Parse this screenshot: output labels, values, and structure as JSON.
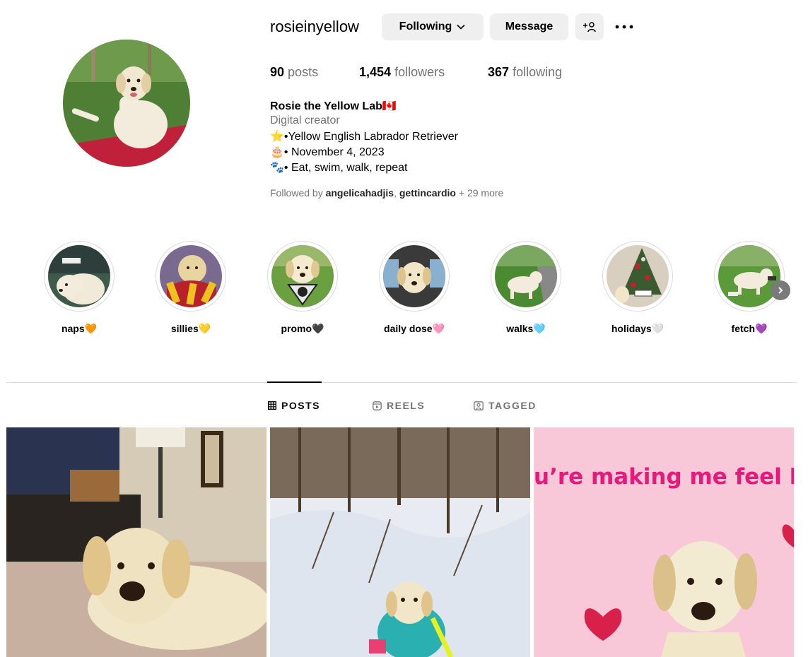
{
  "profile": {
    "username": "rosieinyellow",
    "following_btn": "Following",
    "message_btn": "Message",
    "add_user_icon": "add-user-icon",
    "more_icon": "more-dots-icon"
  },
  "stats": {
    "posts_count": "90",
    "posts_label": "posts",
    "followers_count": "1,454",
    "followers_label": "followers",
    "following_count": "367",
    "following_label": "following"
  },
  "bio": {
    "name": "Rosie the Yellow Lab🇨🇦",
    "category": "Digital creator",
    "lines": [
      "⭐️•Yellow English Labrador Retriever",
      "🎂• November 4, 2023",
      "🐾• Eat, swim, walk, repeat"
    ],
    "followed_prefix": "Followed by ",
    "followed_user1": "angelicahadjis",
    "followed_sep": ", ",
    "followed_user2": "gettincardio",
    "followed_more": " + 29 more"
  },
  "highlights": [
    {
      "label": "naps🧡"
    },
    {
      "label": "sillies💛"
    },
    {
      "label": "promo🖤"
    },
    {
      "label": "daily dose🩷"
    },
    {
      "label": "walks🩵"
    },
    {
      "label": "holidays🤍"
    },
    {
      "label": "fetch💜"
    }
  ],
  "tabs": {
    "posts": "POSTS",
    "reels": "REELS",
    "tagged": "TAGGED"
  },
  "posts": {
    "post3_caption": "u’re making me feel Ros"
  },
  "colors": {
    "button_bg": "#efefef",
    "secondary_text": "#737373",
    "border": "#dbdbdb",
    "post3_text": "#e8197a",
    "post3_bg": "#f8c8d8"
  }
}
